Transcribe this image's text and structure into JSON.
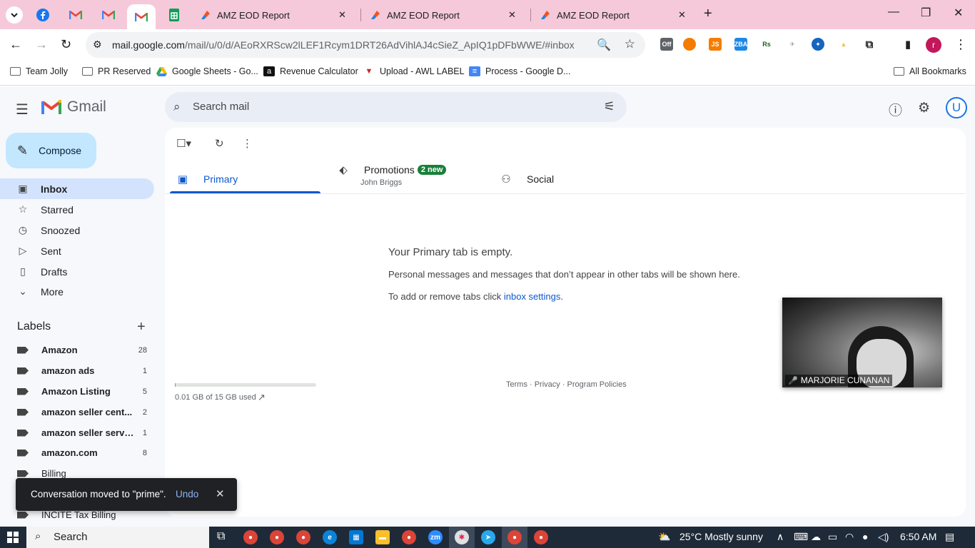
{
  "browser": {
    "tabs": [
      {
        "title": "AMZ EOD Report"
      },
      {
        "title": "AMZ EOD Report"
      },
      {
        "title": "AMZ EOD Report"
      }
    ],
    "url_host": "mail.google.com",
    "url_path": "/mail/u/0/d/AEoRXRScw2lLEF1Rcym1DRT26AdVihlAJ4cSieZ_ApIQ1pDFbWWE/#inbox",
    "profile_initial": "r",
    "extensions": [
      {
        "label": "Off",
        "color": "#5f6368"
      },
      {
        "label": "",
        "color": "#f57c00"
      },
      {
        "label": "JS",
        "color": "#f57c00"
      },
      {
        "label": "ZBA",
        "color": "#1e88e5"
      },
      {
        "label": "Rs",
        "color": "#1b5e20"
      },
      {
        "label": "",
        "color": "#9e9e9e"
      },
      {
        "label": "",
        "color": "#1565c0"
      },
      {
        "label": "",
        "color": "#fbc02d"
      }
    ],
    "bookmarks": [
      {
        "label": "Team Jolly",
        "icon": "folder-icon"
      },
      {
        "label": "PR Reserved",
        "icon": "folder-icon"
      },
      {
        "label": "Google Sheets - Go...",
        "icon": "google-drive-icon"
      },
      {
        "label": "Revenue Calculator",
        "icon": "amazon-icon"
      },
      {
        "label": "Upload - AWL LABEL",
        "icon": "awl-icon"
      },
      {
        "label": "Process - Google D...",
        "icon": "google-docs-icon"
      }
    ],
    "all_bookmarks": "All Bookmarks"
  },
  "gmail": {
    "logo_text": "Gmail",
    "search_placeholder": "Search mail",
    "avatar_initial": "U",
    "compose_label": "Compose",
    "nav": [
      {
        "label": "Inbox",
        "icon": "inbox-icon",
        "active": true
      },
      {
        "label": "Starred",
        "icon": "star-icon"
      },
      {
        "label": "Snoozed",
        "icon": "clock-icon"
      },
      {
        "label": "Sent",
        "icon": "send-icon"
      },
      {
        "label": "Drafts",
        "icon": "draft-icon"
      },
      {
        "label": "More",
        "icon": "chevron-down-icon"
      }
    ],
    "labels_header": "Labels",
    "labels": [
      {
        "name": "Amazon",
        "count": "28"
      },
      {
        "name": "amazon ads",
        "count": "1"
      },
      {
        "name": "Amazon Listing",
        "count": "5"
      },
      {
        "name": "amazon seller cent...",
        "count": "2"
      },
      {
        "name": "amazon seller servi...",
        "count": "1"
      },
      {
        "name": "amazon.com",
        "count": "8"
      },
      {
        "name": "Billing",
        "count": ""
      },
      {
        "name": "INCITE Tax Billing",
        "count": ""
      }
    ],
    "category_tabs": {
      "primary": "Primary",
      "promotions": "Promotions",
      "promotions_badge": "2 new",
      "promotions_sender": "John Briggs",
      "social": "Social"
    },
    "empty": {
      "title": "Your Primary tab is empty.",
      "message": "Personal messages and messages that don’t appear in other tabs will be shown here.",
      "hint_prefix": "To add or remove tabs click ",
      "hint_link": "inbox settings",
      "hint_suffix": "."
    },
    "storage": {
      "used_text": "0.01 GB of 15 GB used",
      "fraction": 0.001
    },
    "footer": "Terms · Privacy · Program Policies",
    "video_caption": "MARJORIE CUNANAN",
    "snackbar": {
      "message": "Conversation moved to \"prime\".",
      "action": "Undo"
    }
  },
  "taskbar": {
    "search_label": "Search",
    "weather": "25°C  Mostly sunny",
    "time": "6:50 AM"
  }
}
